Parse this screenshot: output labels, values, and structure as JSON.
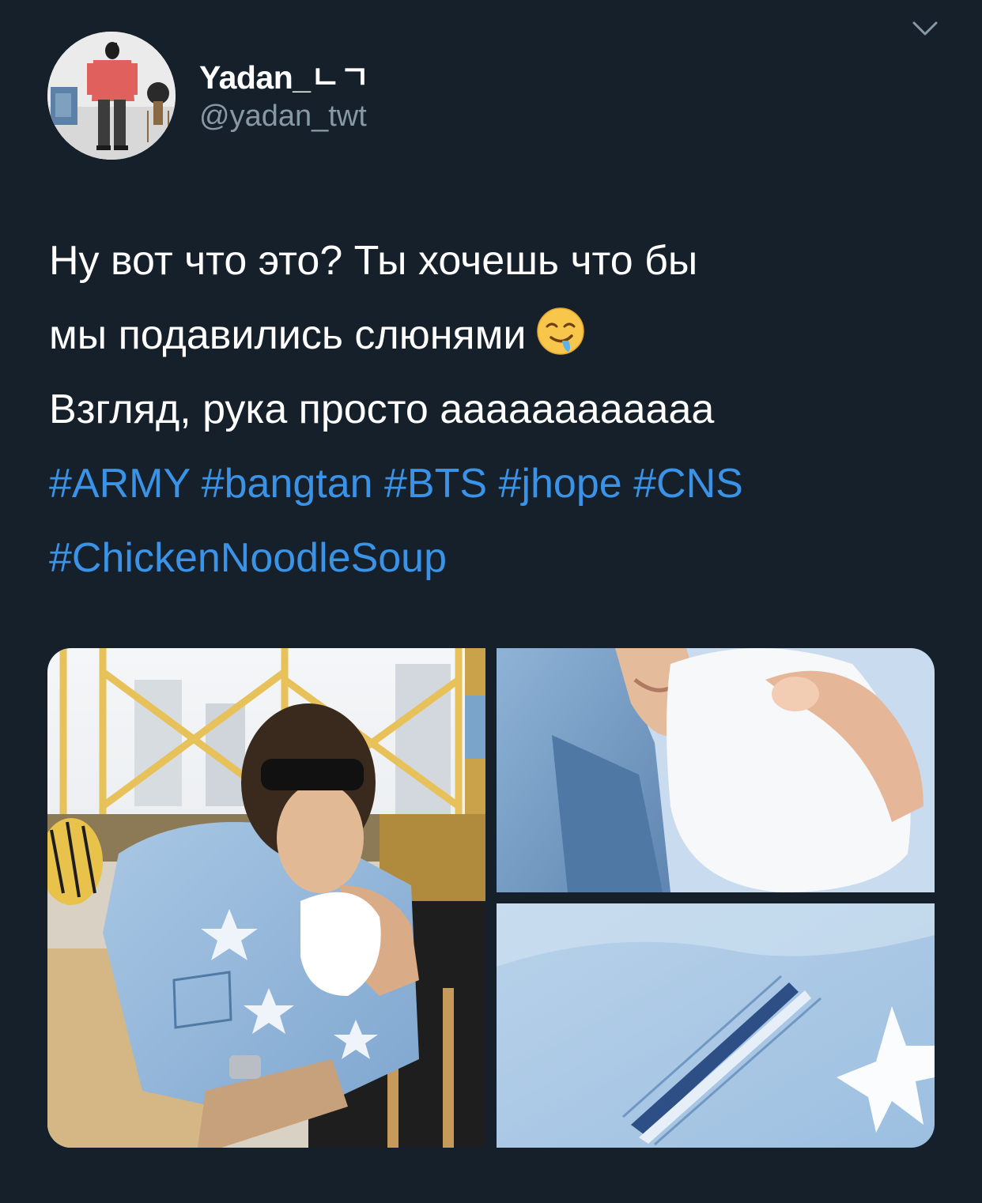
{
  "tweet": {
    "display_name": "Yadan_ㄴㄱ",
    "handle": "@yadan_twt",
    "menu_icon": "chevron-down-icon",
    "text_lines": [
      "Ну вот что это? Ты хочешь что бы",
      "мы подавились слюнями",
      "Взгляд, рука просто аааааааааааа"
    ],
    "emoji_name": "drooling-face-icon",
    "hashtags_line1": [
      "#ARMY",
      "#bangtan",
      "#BTS",
      "#jhope",
      "#CNS"
    ],
    "hashtags_line2": [
      "#ChickenNoodleSoup"
    ],
    "hashtag_color": "#3a93e6",
    "background_color": "#15202b",
    "handle_color": "#8899a6"
  },
  "media": {
    "photos": [
      "man-in-denim-jacket-photo",
      "towel-closeup-photo",
      "denim-pocket-closeup-photo"
    ]
  }
}
